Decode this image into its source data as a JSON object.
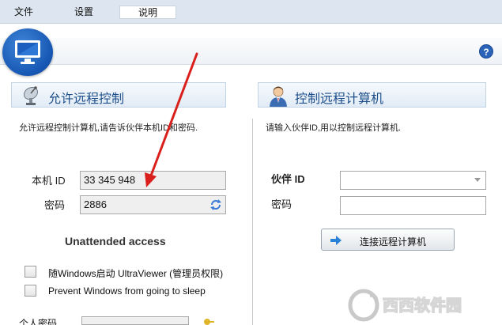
{
  "menu": {
    "file": "文件",
    "settings": "设置",
    "help": "说明"
  },
  "help_button": "?",
  "allow": {
    "title": "允许远程控制",
    "description": "允许远程控制计算机,请告诉伙伴本机ID和密码.",
    "id_label": "本机 ID",
    "id_value": "33 345 948",
    "password_label": "密码",
    "password_value": "2886"
  },
  "control": {
    "title": "控制远程计算机",
    "description": "请输入伙伴ID,用以控制远程计算机.",
    "partner_id_label": "伙伴 ID",
    "partner_id_value": "",
    "password_label": "密码",
    "password_value": "",
    "connect_button": "连接远程计算机"
  },
  "unattended": {
    "title": "Unattended access",
    "start_with_windows": "随Windows启动 UltraViewer (管理员权限)",
    "prevent_sleep": "Prevent Windows from going to sleep",
    "personal_password_label": "个人密码"
  },
  "watermark": {
    "text": "西西软件园"
  },
  "colors": {
    "accent": "#1f4f8a",
    "menubar": "#dde6f0",
    "annotation_arrow": "#d9201c"
  }
}
